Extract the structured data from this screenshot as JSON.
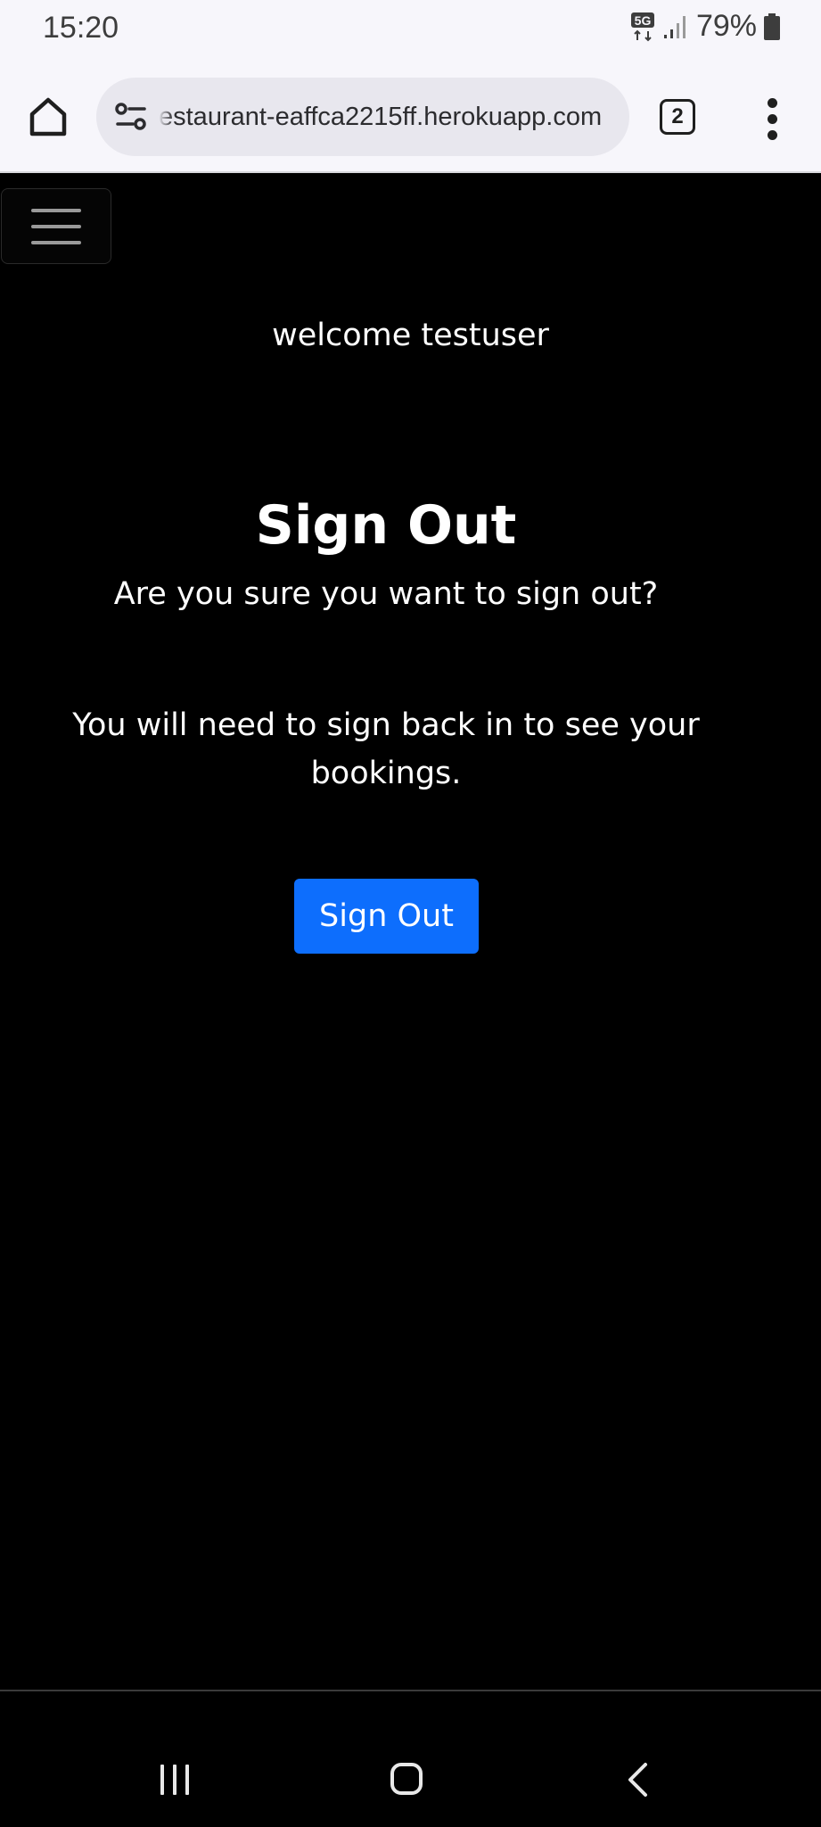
{
  "status_bar": {
    "time": "15:20",
    "network": "5G",
    "battery": "79%"
  },
  "browser": {
    "url": "estaurant-eaffca2215ff.herokuapp.com",
    "tab_count": "2",
    "icons": [
      "home-icon",
      "site-settings-icon",
      "tabs-icon",
      "more-vert-icon"
    ]
  },
  "page": {
    "welcome": "welcome testuser",
    "title": "Sign Out",
    "question": "Are you sure you want to sign out?",
    "info": "You will need to sign back in to see your bookings.",
    "signout_button": "Sign Out",
    "accent_color": "#0d6efd"
  },
  "system_nav": {
    "icons": [
      "recent-apps-icon",
      "home-icon",
      "back-icon"
    ]
  }
}
